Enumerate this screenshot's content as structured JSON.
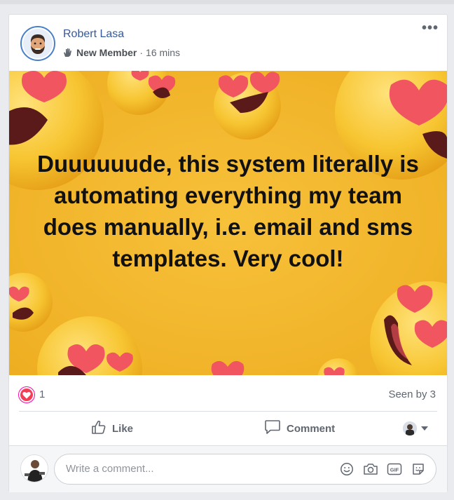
{
  "post": {
    "author": "Robert Lasa",
    "badge": "New Member",
    "separator": "·",
    "time": "16 mins",
    "more_icon": "more-horizontal-icon",
    "caption": "Duuuuuude, this system literally is automating everything my team does manually, i.e. email and sms templates. Very cool!",
    "background_color": "#f3b82b"
  },
  "stats": {
    "reaction_icon": "heart-reaction-icon",
    "reaction_count": "1",
    "seen_by": "Seen by 3"
  },
  "actions": {
    "like_label": "Like",
    "comment_label": "Comment"
  },
  "composer": {
    "placeholder": "Write a comment...",
    "icons": [
      "emoji-icon",
      "camera-icon",
      "gif-icon",
      "sticker-icon"
    ]
  },
  "colors": {
    "link": "#365899",
    "heart": "#f33e58",
    "muted": "#606770"
  }
}
